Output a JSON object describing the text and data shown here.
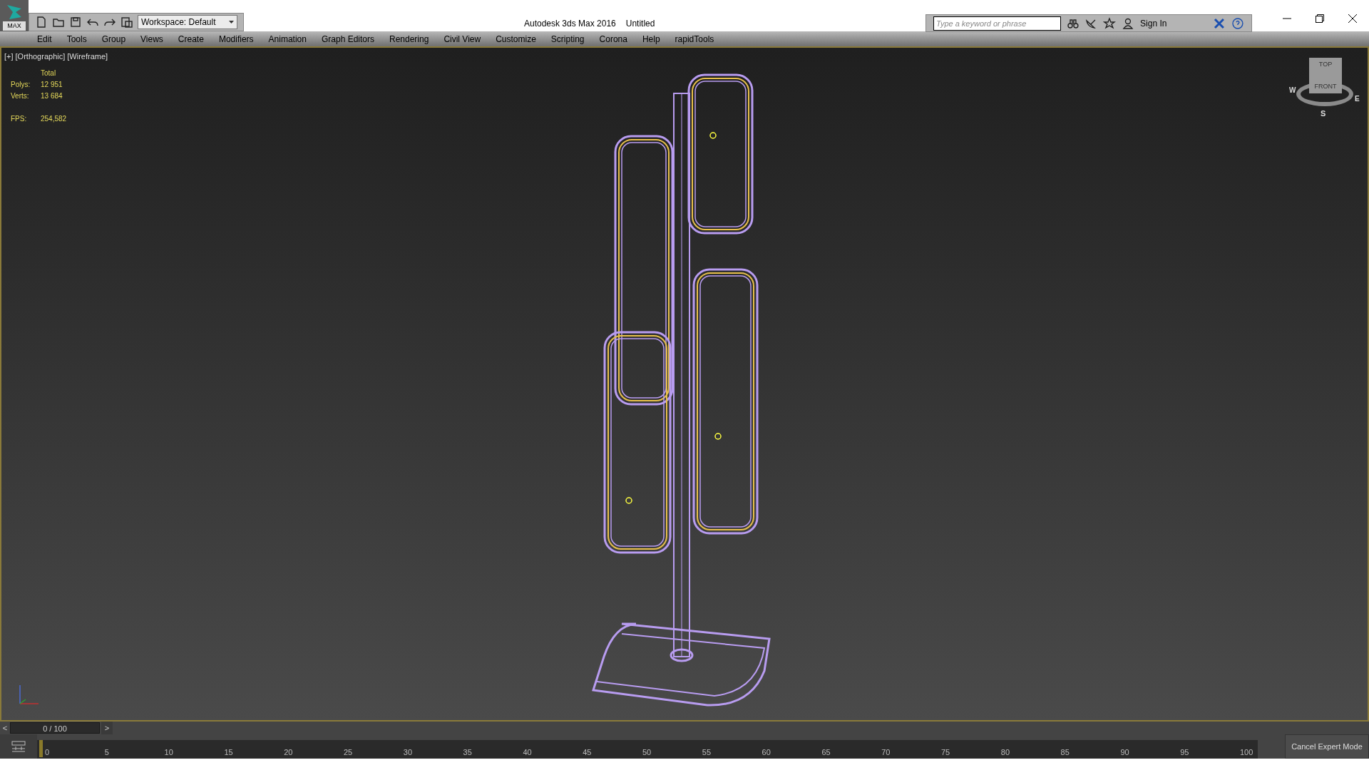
{
  "app_button": {
    "label": "MAX"
  },
  "workspace": {
    "value": "Workspace: Default"
  },
  "window": {
    "title": "Autodesk 3ds Max 2016",
    "document": "Untitled"
  },
  "search": {
    "placeholder": "Type a keyword or phrase"
  },
  "account": {
    "label": "Sign In"
  },
  "menu": [
    "Edit",
    "Tools",
    "Group",
    "Views",
    "Create",
    "Modifiers",
    "Animation",
    "Graph Editors",
    "Rendering",
    "Civil View",
    "Customize",
    "Scripting",
    "Corona",
    "Help",
    "rapidTools"
  ],
  "viewport": {
    "labels": [
      "[+]",
      "[Orthographic]",
      "[Wireframe]"
    ],
    "stats": {
      "header": "Total",
      "rows": [
        {
          "label": "Polys:",
          "value": "12 951"
        },
        {
          "label": "Verts:",
          "value": "13 684"
        }
      ],
      "fps_label": "FPS:",
      "fps_value": "254,582"
    },
    "viewcube": {
      "face_top": "TOP",
      "face_front": "FRONT",
      "west": "W",
      "east": "E",
      "south": "S"
    }
  },
  "time_slider": {
    "prev": "<",
    "frame": "0 / 100",
    "next": ">",
    "level": 0
  },
  "trackbar": {
    "ticks": [
      "0",
      "5",
      "10",
      "15",
      "20",
      "25",
      "30",
      "35",
      "40",
      "45",
      "50",
      "55",
      "60",
      "65",
      "70",
      "75",
      "80",
      "85",
      "90",
      "95",
      "100"
    ]
  },
  "expert_button": {
    "label": "Cancel Expert Mode"
  }
}
